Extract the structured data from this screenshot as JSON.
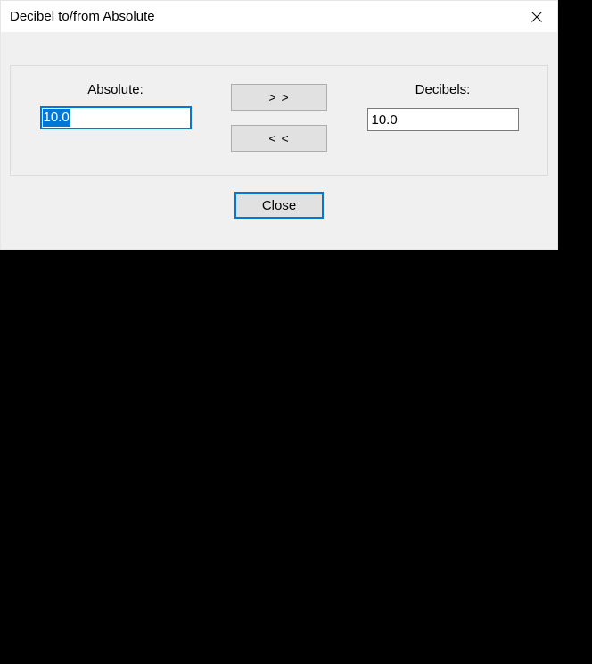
{
  "window": {
    "title": "Decibel to/from Absolute"
  },
  "form": {
    "absolute_label": "Absolute:",
    "absolute_value": "10.0",
    "decibels_label": "Decibels:",
    "decibels_value": "10.0",
    "to_decibels_label": "> >",
    "to_absolute_label": "< <"
  },
  "footer": {
    "close_label": "Close"
  }
}
